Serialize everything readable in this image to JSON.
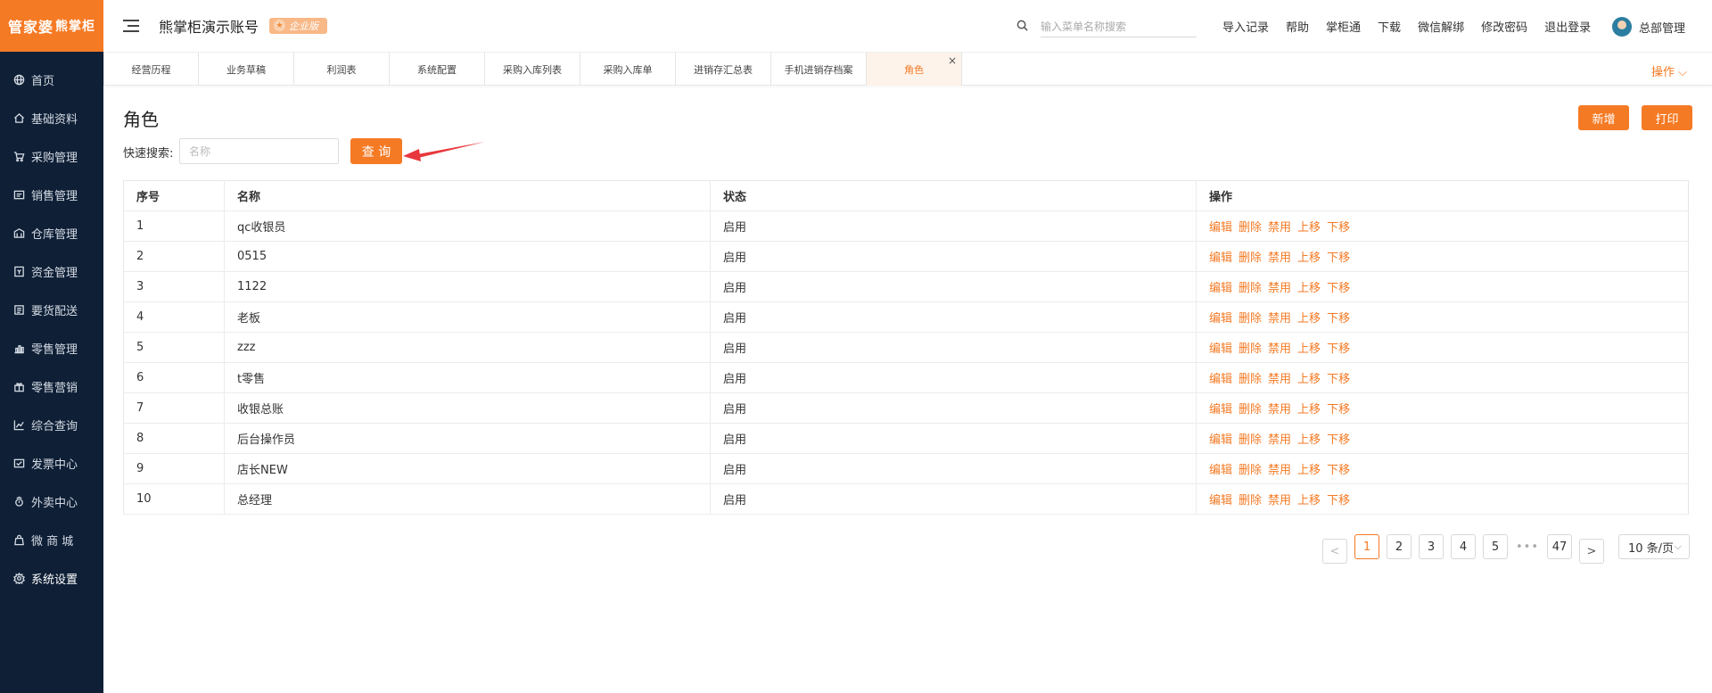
{
  "brand": {
    "logo_main": "管家婆",
    "logo_sub": "熊掌柜"
  },
  "sidebar": {
    "items": [
      {
        "label": "首页",
        "icon": "globe-icon"
      },
      {
        "label": "基础资料",
        "icon": "home-icon"
      },
      {
        "label": "采购管理",
        "icon": "cart-icon"
      },
      {
        "label": "销售管理",
        "icon": "sales-icon"
      },
      {
        "label": "仓库管理",
        "icon": "warehouse-icon"
      },
      {
        "label": "资金管理",
        "icon": "money-icon"
      },
      {
        "label": "要货配送",
        "icon": "delivery-icon"
      },
      {
        "label": "零售管理",
        "icon": "retail-icon"
      },
      {
        "label": "零售营销",
        "icon": "gift-icon"
      },
      {
        "label": "综合查询",
        "icon": "chart-icon"
      },
      {
        "label": "发票中心",
        "icon": "invoice-icon"
      },
      {
        "label": "外卖中心",
        "icon": "takeout-icon"
      },
      {
        "label": "微 商 城",
        "icon": "shop-icon"
      },
      {
        "label": "系统设置",
        "icon": "gear-icon"
      }
    ],
    "active_index": 13
  },
  "header": {
    "account_title": "熊掌柜演示账号",
    "edition_badge": "企业版",
    "search_placeholder": "输入菜单名称搜索",
    "links": [
      "导入记录",
      "帮助",
      "掌柜通",
      "下载",
      "微信解绑",
      "修改密码",
      "退出登录"
    ],
    "user_name": "总部管理"
  },
  "tabs": {
    "items": [
      "经营历程",
      "业务草稿",
      "利润表",
      "系统配置",
      "采购入库列表",
      "采购入库单",
      "进销存汇总表",
      "手机进销存档案",
      "角色"
    ],
    "active_index": 8,
    "close_symbol": "×",
    "ops_label": "操作 ⌵"
  },
  "page": {
    "title": "角色",
    "add_label": "新增",
    "print_label": "打印",
    "quick_search_label": "快速搜索:",
    "quick_search_placeholder": "名称",
    "query_label": "查 询"
  },
  "table": {
    "headers": [
      "序号",
      "名称",
      "状态",
      "操作"
    ],
    "actions": [
      "编辑",
      "删除",
      "禁用",
      "上移",
      "下移"
    ],
    "rows": [
      {
        "idx": "1",
        "name": "qc收银员",
        "status": "启用"
      },
      {
        "idx": "2",
        "name": "0515",
        "status": "启用"
      },
      {
        "idx": "3",
        "name": "1122",
        "status": "启用"
      },
      {
        "idx": "4",
        "name": "老板",
        "status": "启用"
      },
      {
        "idx": "5",
        "name": "zzz",
        "status": "启用"
      },
      {
        "idx": "6",
        "name": "t零售",
        "status": "启用"
      },
      {
        "idx": "7",
        "name": "收银总账",
        "status": "启用"
      },
      {
        "idx": "8",
        "name": "后台操作员",
        "status": "启用"
      },
      {
        "idx": "9",
        "name": "店长NEW",
        "status": "启用"
      },
      {
        "idx": "10",
        "name": "总经理",
        "status": "启用"
      }
    ]
  },
  "pagination": {
    "prev": "<",
    "pages": [
      "1",
      "2",
      "3",
      "4",
      "5"
    ],
    "ellipsis": "•••",
    "last": "47",
    "next": ">",
    "current": "1",
    "page_size": "10 条/页",
    "page_size_arrow": "⌵"
  },
  "colors": {
    "accent": "#f57a24",
    "sidebar_bg": "#0e1f36",
    "arrow": "#e8383d"
  }
}
